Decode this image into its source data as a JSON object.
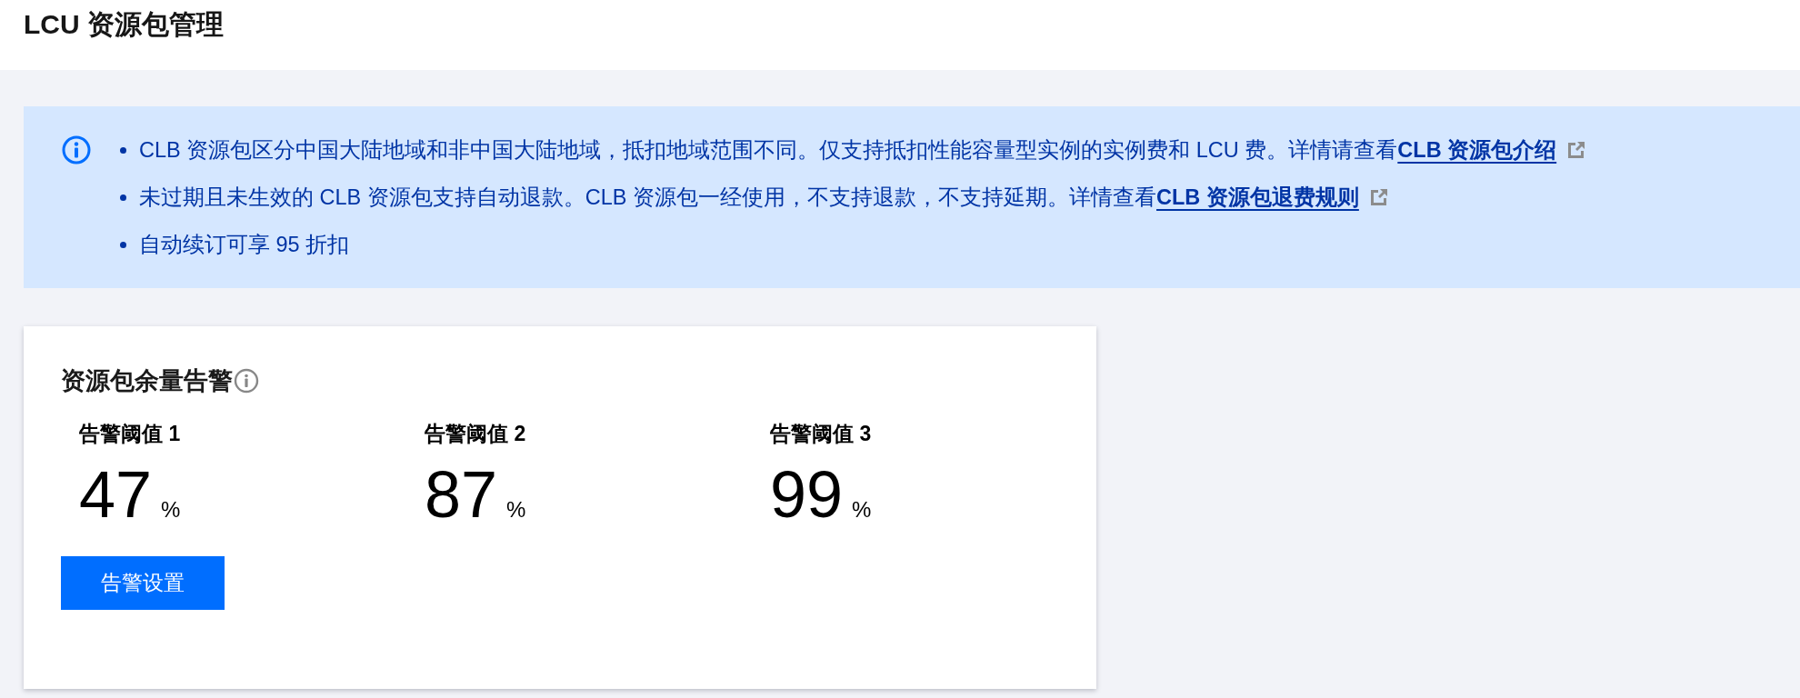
{
  "page": {
    "title": "LCU 资源包管理"
  },
  "notice": {
    "items": [
      {
        "text": "CLB 资源包区分中国大陆地域和非中国大陆地域，抵扣地域范围不同。仅支持抵扣性能容量型实例的实例费和 LCU 费。详情请查看",
        "link": "CLB 资源包介绍"
      },
      {
        "text": "未过期且未生效的 CLB 资源包支持自动退款。CLB 资源包一经使用，不支持退款，不支持延期。详情查看",
        "link": "CLB 资源包退费规则"
      },
      {
        "text": "自动续订可享 95 折扣"
      }
    ]
  },
  "alert_card": {
    "title": "资源包余量告警",
    "thresholds": [
      {
        "label": "告警阈值 1",
        "value": "47",
        "unit": "%"
      },
      {
        "label": "告警阈值 2",
        "value": "87",
        "unit": "%"
      },
      {
        "label": "告警阈值 3",
        "value": "99",
        "unit": "%"
      }
    ],
    "button": "告警设置"
  }
}
